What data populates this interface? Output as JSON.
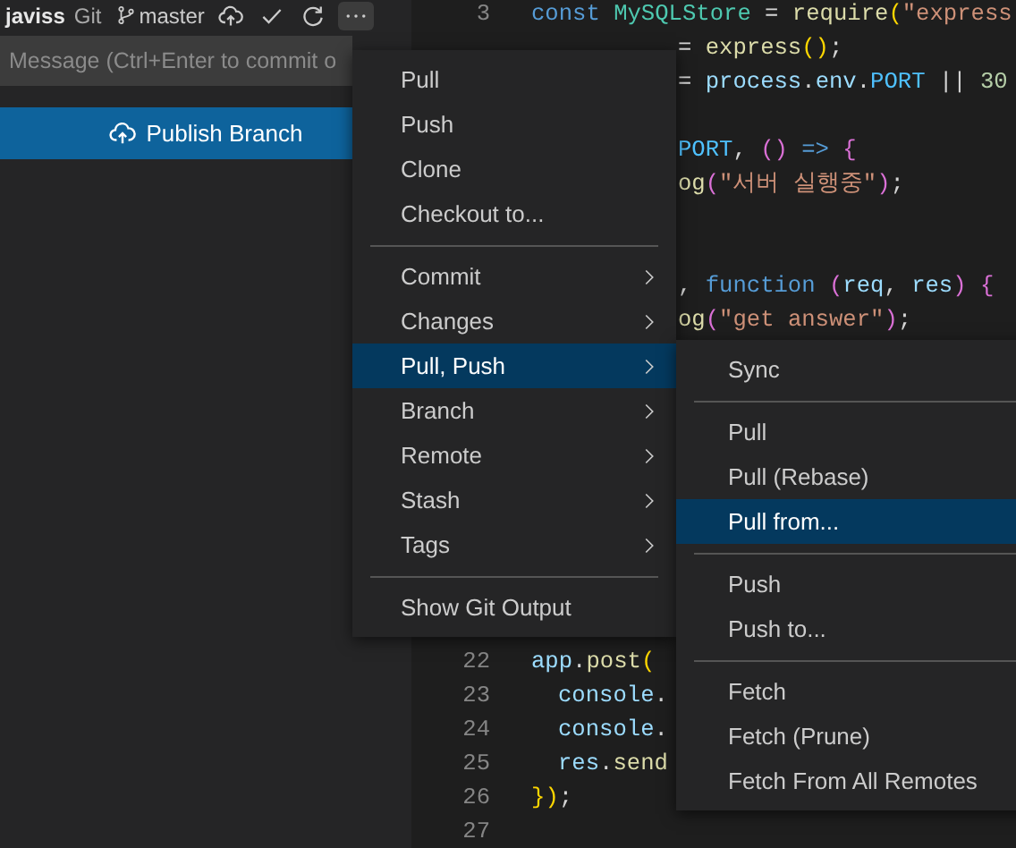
{
  "scm": {
    "title": "javiss",
    "provider": "Git",
    "branch": "master"
  },
  "commit_message": {
    "placeholder": "Message (Ctrl+Enter to commit o"
  },
  "publish_button": {
    "label": "Publish Branch"
  },
  "editor": {
    "top_lines": [
      {
        "kind": "code",
        "number": "3",
        "tokens": [
          {
            "text": "const ",
            "kind": "kw"
          },
          {
            "text": "MySQLStore",
            "kind": "cls"
          },
          {
            "text": " = ",
            "kind": "pun"
          },
          {
            "text": "require",
            "kind": "fn"
          },
          {
            "text": "(",
            "kind": "br"
          },
          {
            "text": "\"express",
            "kind": "str"
          }
        ]
      },
      {
        "kind": "code",
        "tokens": [
          {
            "text": "= ",
            "kind": "pun"
          },
          {
            "text": "express",
            "kind": "fn"
          },
          {
            "text": "()",
            "kind": "br"
          },
          {
            "text": ";",
            "kind": "pun"
          }
        ]
      },
      {
        "kind": "code",
        "tokens": [
          {
            "text": "= ",
            "kind": "pun"
          },
          {
            "text": "process",
            "kind": "var"
          },
          {
            "text": ".",
            "kind": "pun"
          },
          {
            "text": "env",
            "kind": "var"
          },
          {
            "text": ".",
            "kind": "pun"
          },
          {
            "text": "PORT",
            "kind": "const"
          },
          {
            "text": " || ",
            "kind": "pun"
          },
          {
            "text": "30",
            "kind": "num"
          }
        ]
      },
      {
        "kind": "blank"
      },
      {
        "kind": "code",
        "tokens": [
          {
            "text": "PORT",
            "kind": "const"
          },
          {
            "text": ", ",
            "kind": "pun"
          },
          {
            "text": "()",
            "kind": "br2"
          },
          {
            "text": " => ",
            "kind": "kw"
          },
          {
            "text": "{",
            "kind": "br2"
          }
        ]
      },
      {
        "kind": "code",
        "tokens": [
          {
            "text": "og",
            "kind": "fn"
          },
          {
            "text": "(",
            "kind": "br2"
          },
          {
            "text": "\"서버 실행중\"",
            "kind": "str"
          },
          {
            "text": ")",
            "kind": "br2"
          },
          {
            "text": ";",
            "kind": "pun"
          }
        ]
      },
      {
        "kind": "blank"
      },
      {
        "kind": "blank"
      },
      {
        "kind": "code",
        "tokens": [
          {
            "text": ", ",
            "kind": "pun"
          },
          {
            "text": "function ",
            "kind": "kw"
          },
          {
            "text": "(",
            "kind": "br2"
          },
          {
            "text": "req",
            "kind": "var"
          },
          {
            "text": ", ",
            "kind": "pun"
          },
          {
            "text": "res",
            "kind": "var"
          },
          {
            "text": ")",
            "kind": "br2"
          },
          {
            "text": " {",
            "kind": "br2"
          }
        ]
      },
      {
        "kind": "code",
        "tokens": [
          {
            "text": "og",
            "kind": "fn"
          },
          {
            "text": "(",
            "kind": "br2"
          },
          {
            "text": "\"get answer\"",
            "kind": "str"
          },
          {
            "text": ")",
            "kind": "br2"
          },
          {
            "text": ";",
            "kind": "pun"
          }
        ]
      }
    ],
    "bottom_lines": [
      {
        "kind": "code",
        "number": "22",
        "tokens": [
          {
            "text": "app",
            "kind": "var"
          },
          {
            "text": ".",
            "kind": "pun"
          },
          {
            "text": "post",
            "kind": "fn"
          },
          {
            "text": "(",
            "kind": "br"
          }
        ],
        "children": [
          {
            "kind": "code",
            "number": "23",
            "tokens": [
              {
                "text": "console",
                "kind": "var"
              },
              {
                "text": ".",
                "kind": "pun"
              }
            ]
          },
          {
            "kind": "code",
            "number": "24",
            "tokens": [
              {
                "text": "console",
                "kind": "var"
              },
              {
                "text": ".",
                "kind": "pun"
              }
            ]
          },
          {
            "kind": "code",
            "number": "25",
            "tokens": [
              {
                "text": "res",
                "kind": "var"
              },
              {
                "text": ".",
                "kind": "pun"
              },
              {
                "text": "send",
                "kind": "fn"
              }
            ]
          }
        ]
      },
      {
        "kind": "code",
        "number": "26",
        "tokens": [
          {
            "text": "}",
            "kind": "br"
          },
          {
            "text": ")",
            "kind": "br"
          },
          {
            "text": ";",
            "kind": "pun"
          }
        ]
      },
      {
        "kind": "code",
        "number": "27"
      }
    ]
  },
  "menu": {
    "items": [
      {
        "kind": "item",
        "label": "Pull",
        "selected": false
      },
      {
        "kind": "item",
        "label": "Push",
        "selected": false
      },
      {
        "kind": "item",
        "label": "Clone",
        "selected": false
      },
      {
        "kind": "item",
        "label": "Checkout to...",
        "selected": false
      },
      {
        "kind": "separator"
      },
      {
        "kind": "submenu",
        "label": "Commit",
        "selected": false
      },
      {
        "kind": "submenu",
        "label": "Changes",
        "selected": false
      },
      {
        "kind": "submenu",
        "label": "Pull, Push",
        "selected": true
      },
      {
        "kind": "submenu",
        "label": "Branch",
        "selected": false
      },
      {
        "kind": "submenu",
        "label": "Remote",
        "selected": false
      },
      {
        "kind": "submenu",
        "label": "Stash",
        "selected": false
      },
      {
        "kind": "submenu",
        "label": "Tags",
        "selected": false
      },
      {
        "kind": "separator"
      },
      {
        "kind": "item",
        "label": "Show Git Output",
        "selected": false
      }
    ]
  },
  "submenu": {
    "items": [
      {
        "kind": "item",
        "label": "Sync",
        "selected": false
      },
      {
        "kind": "separator"
      },
      {
        "kind": "item",
        "label": "Pull",
        "selected": false
      },
      {
        "kind": "item",
        "label": "Pull (Rebase)",
        "selected": false
      },
      {
        "kind": "item",
        "label": "Pull from...",
        "selected": true
      },
      {
        "kind": "separator"
      },
      {
        "kind": "item",
        "label": "Push",
        "selected": false
      },
      {
        "kind": "item",
        "label": "Push to...",
        "selected": false
      },
      {
        "kind": "separator"
      },
      {
        "kind": "item",
        "label": "Fetch",
        "selected": false
      },
      {
        "kind": "item",
        "label": "Fetch (Prune)",
        "selected": false
      },
      {
        "kind": "item",
        "label": "Fetch From All Remotes",
        "selected": false
      }
    ]
  }
}
